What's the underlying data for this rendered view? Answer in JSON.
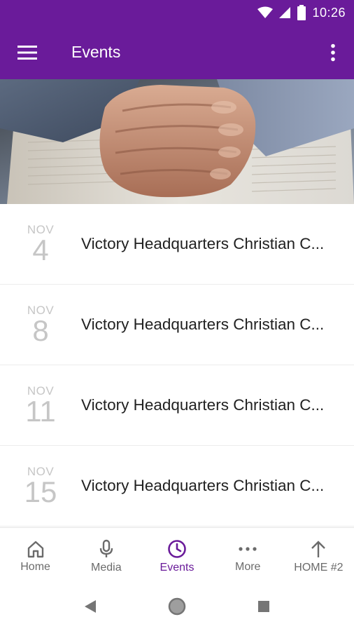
{
  "status_bar": {
    "time": "10:26",
    "icons": [
      "wifi-icon",
      "signal-icon",
      "battery-icon"
    ]
  },
  "app_bar": {
    "title": "Events",
    "menu_icon": "hamburger-menu-icon",
    "overflow_icon": "more-vertical-icon"
  },
  "hero": {
    "image": "praying-hands-on-bible"
  },
  "events": [
    {
      "month": "NOV",
      "day": "4",
      "title": "Victory Headquarters Christian C..."
    },
    {
      "month": "NOV",
      "day": "8",
      "title": "Victory Headquarters Christian C..."
    },
    {
      "month": "NOV",
      "day": "11",
      "title": "Victory Headquarters Christian C..."
    },
    {
      "month": "NOV",
      "day": "15",
      "title": "Victory Headquarters Christian C..."
    }
  ],
  "bottom_nav": {
    "items": [
      {
        "label": "Home",
        "icon": "home-icon",
        "active": false
      },
      {
        "label": "Media",
        "icon": "microphone-icon",
        "active": false
      },
      {
        "label": "Events",
        "icon": "clock-icon",
        "active": true
      },
      {
        "label": "More",
        "icon": "more-horizontal-icon",
        "active": false
      },
      {
        "label": "HOME #2",
        "icon": "arrow-up-icon",
        "active": false
      }
    ]
  },
  "colors": {
    "primary": "#6a1b9a",
    "inactive": "#6b6b6b",
    "date_text": "#c6c6c6"
  }
}
